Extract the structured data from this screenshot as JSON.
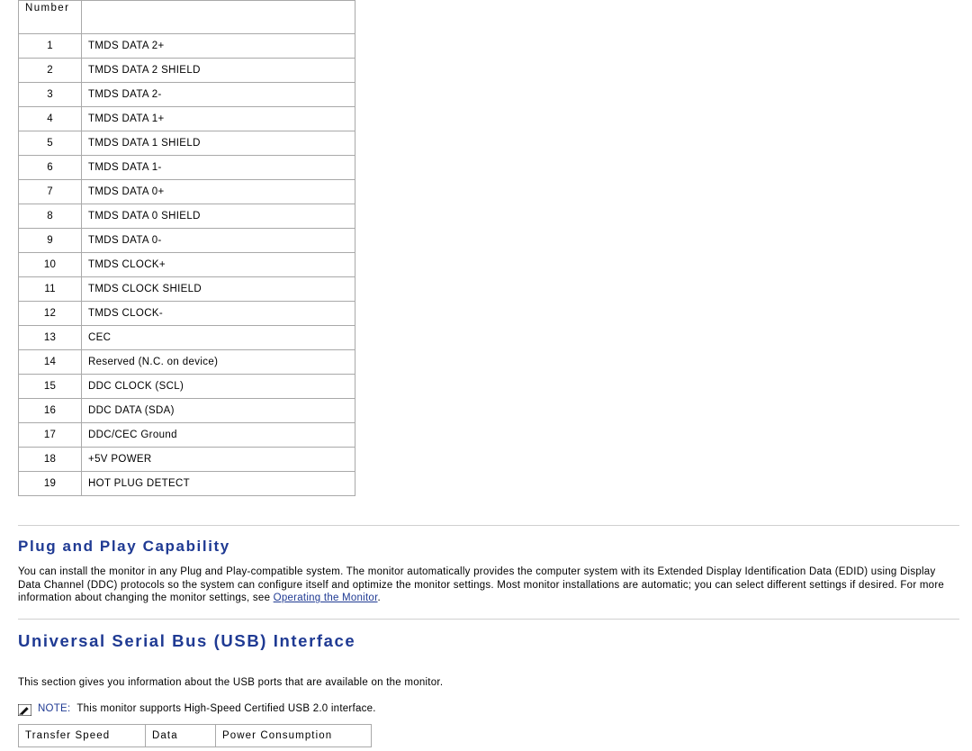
{
  "pin_table": {
    "headers": [
      "Number",
      ""
    ],
    "rows": [
      {
        "number": "1",
        "signal": "TMDS DATA 2+"
      },
      {
        "number": "2",
        "signal": "TMDS DATA 2 SHIELD"
      },
      {
        "number": "3",
        "signal": "TMDS DATA 2-"
      },
      {
        "number": "4",
        "signal": "TMDS DATA 1+"
      },
      {
        "number": "5",
        "signal": "TMDS DATA 1 SHIELD"
      },
      {
        "number": "6",
        "signal": "TMDS DATA 1-"
      },
      {
        "number": "7",
        "signal": "TMDS DATA 0+"
      },
      {
        "number": "8",
        "signal": "TMDS DATA 0 SHIELD"
      },
      {
        "number": "9",
        "signal": "TMDS DATA 0-"
      },
      {
        "number": "10",
        "signal": "TMDS CLOCK+"
      },
      {
        "number": "11",
        "signal": "TMDS CLOCK SHIELD"
      },
      {
        "number": "12",
        "signal": "TMDS CLOCK-"
      },
      {
        "number": "13",
        "signal": "CEC"
      },
      {
        "number": "14",
        "signal": "Reserved (N.C. on device)"
      },
      {
        "number": "15",
        "signal": "DDC CLOCK (SCL)"
      },
      {
        "number": "16",
        "signal": "DDC DATA (SDA)"
      },
      {
        "number": "17",
        "signal": "DDC/CEC Ground"
      },
      {
        "number": "18",
        "signal": "+5V POWER"
      },
      {
        "number": "19",
        "signal": "HOT PLUG DETECT"
      }
    ]
  },
  "plug_and_play": {
    "heading": "Plug and Play Capability",
    "paragraph_part1": "You can install the monitor in any Plug and Play-compatible system. The monitor automatically provides the computer system with its Extended Display Identification Data (EDID) using Display Data Channel (DDC) protocols so the system can configure itself and optimize the monitor settings. Most monitor installations are automatic; you can select different settings if desired. For more information about changing the monitor settings, see ",
    "link_text": "Operating the Monitor",
    "paragraph_part2": "."
  },
  "usb_section": {
    "heading": "Universal Serial Bus (USB) Interface",
    "intro": "This section gives you information about the USB ports that are available on the monitor.",
    "note_label": "NOTE:",
    "note_text": "This monitor supports High-Speed Certified USB 2.0 interface.",
    "table_headers": [
      "Transfer Speed",
      "Data",
      "Power Consumption"
    ]
  },
  "colors": {
    "heading": "#1f3a93",
    "link": "#1f3a93",
    "border": "#a9a9a9",
    "rule": "#d0d0d0"
  }
}
